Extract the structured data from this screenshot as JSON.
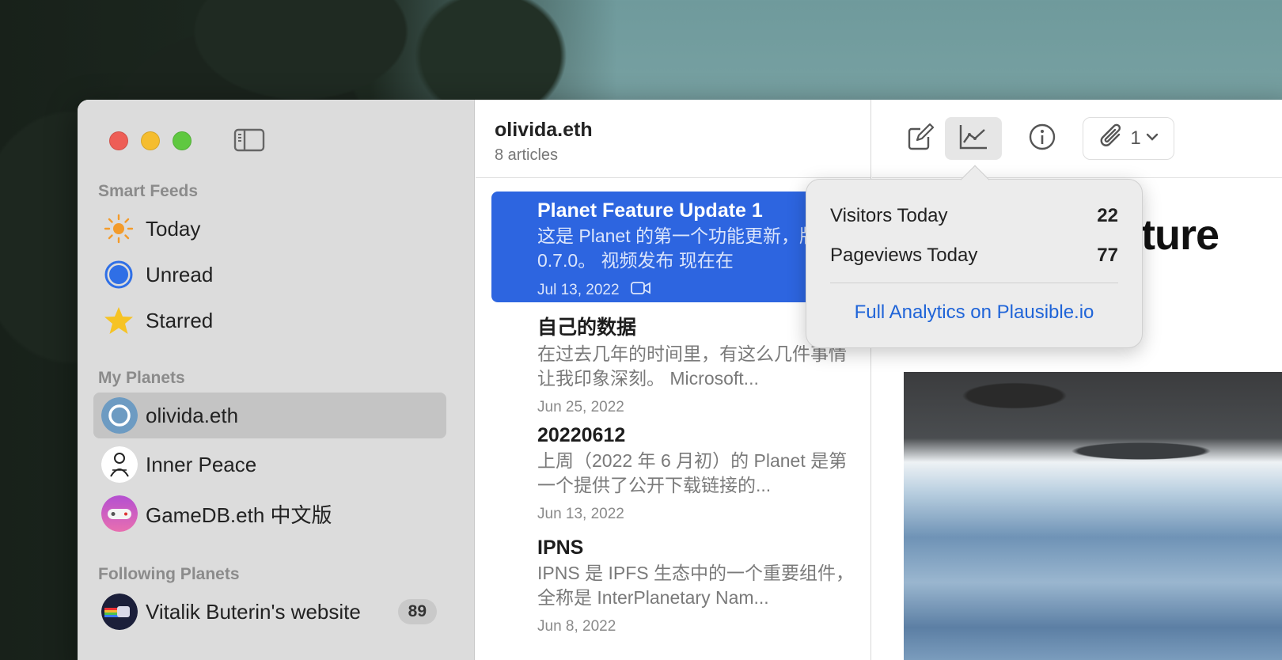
{
  "sidebar": {
    "smart_feeds_title": "Smart Feeds",
    "smart_feeds": [
      {
        "label": "Today",
        "icon": "sun-icon"
      },
      {
        "label": "Unread",
        "icon": "unread-circle-icon"
      },
      {
        "label": "Starred",
        "icon": "star-icon"
      }
    ],
    "my_planets_title": "My Planets",
    "my_planets": [
      {
        "label": "olivida.eth",
        "selected": true
      },
      {
        "label": "Inner Peace"
      },
      {
        "label": "GameDB.eth 中文版"
      }
    ],
    "following_title": "Following Planets",
    "following": [
      {
        "label": "Vitalik Buterin's website",
        "badge": "89"
      }
    ]
  },
  "list": {
    "title": "olivida.eth",
    "subtitle": "8 articles",
    "articles": [
      {
        "title": "Planet Feature Update 1",
        "body": "这是 Planet 的第一个功能更新，版本号 0.7.0。 视频发布 现在在",
        "date": "Jul 13, 2022",
        "has_video": true
      },
      {
        "title": "自己的数据",
        "body": "在过去几年的时间里，有这么几件事情让我印象深刻。 Microsoft...",
        "date": "Jun 25, 2022"
      },
      {
        "title": "20220612",
        "body": "上周（2022 年 6 月初）的 Planet 是第一个提供了公开下载链接的...",
        "date": "Jun 13, 2022"
      },
      {
        "title": "IPNS",
        "body": "IPNS 是 IPFS 生态中的一个重要组件，全称是 InterPlanetary Nam...",
        "date": "Jun 8, 2022"
      }
    ]
  },
  "toolbar": {
    "attachments_count": "1"
  },
  "detail": {
    "title_fragment": "ture"
  },
  "analytics_popover": {
    "visitors_label": "Visitors Today",
    "visitors_value": "22",
    "pageviews_label": "Pageviews Today",
    "pageviews_value": "77",
    "link": "Full Analytics on Plausible.io"
  },
  "colors": {
    "selection_blue": "#2d65e0",
    "link_blue": "#1f64d8",
    "sun_orange": "#f39b2b",
    "unread_blue": "#2f6fe6",
    "star_yellow": "#f6c324"
  }
}
